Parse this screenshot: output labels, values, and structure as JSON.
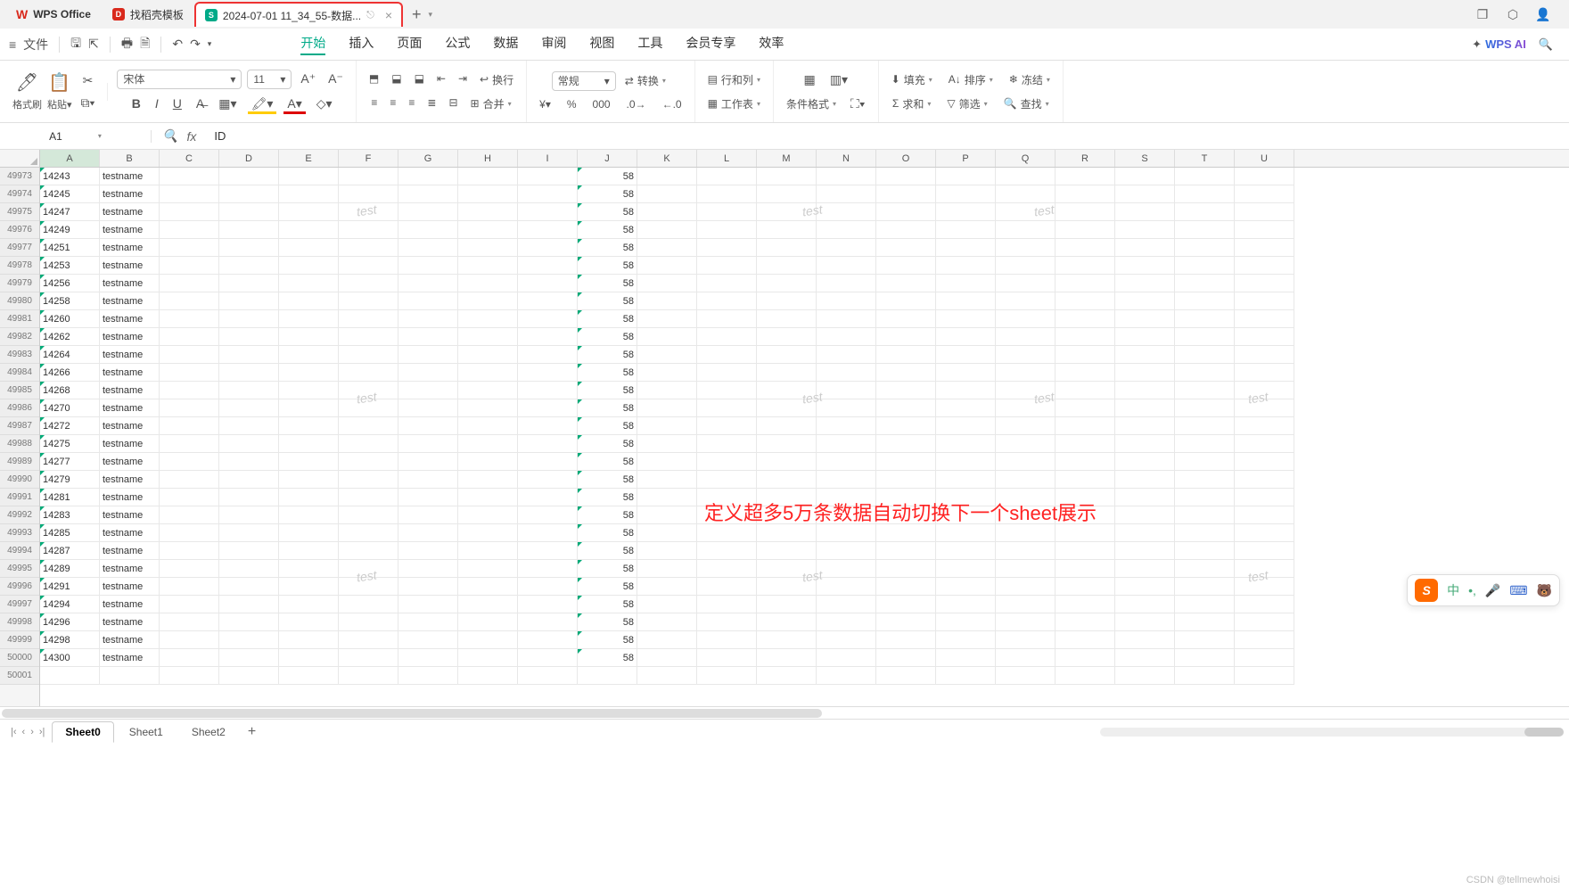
{
  "tabs": {
    "app": "WPS Office",
    "t1": "找稻壳模板",
    "t2": "2024-07-01 11_34_55-数据..."
  },
  "file_menu": "文件",
  "menu": [
    "开始",
    "插入",
    "页面",
    "公式",
    "数据",
    "审阅",
    "视图",
    "工具",
    "会员专享",
    "效率"
  ],
  "wpsai": "WPS AI",
  "ribbon": {
    "format_painter": "格式刷",
    "paste": "粘贴",
    "font_name": "宋体",
    "font_size": "11",
    "wrap": "换行",
    "merge": "合并",
    "num_format": "常规",
    "convert": "转换",
    "rowcol": "行和列",
    "sheet": "工作表",
    "cond": "条件格式",
    "fill": "填充",
    "sort": "排序",
    "freeze": "冻结",
    "sum": "求和",
    "filter": "筛选",
    "find": "查找"
  },
  "name_box": "A1",
  "fx_value": "ID",
  "columns": [
    "A",
    "B",
    "C",
    "D",
    "E",
    "F",
    "G",
    "H",
    "I",
    "J",
    "K",
    "L",
    "M",
    "N",
    "O",
    "P",
    "Q",
    "R",
    "S",
    "T",
    "U"
  ],
  "row_start": 49973,
  "data_rows": [
    {
      "r": 49973,
      "a": "14243",
      "b": "testname",
      "j": "58"
    },
    {
      "r": 49974,
      "a": "14245",
      "b": "testname",
      "j": "58"
    },
    {
      "r": 49975,
      "a": "14247",
      "b": "testname",
      "j": "58"
    },
    {
      "r": 49976,
      "a": "14249",
      "b": "testname",
      "j": "58"
    },
    {
      "r": 49977,
      "a": "14251",
      "b": "testname",
      "j": "58"
    },
    {
      "r": 49978,
      "a": "14253",
      "b": "testname",
      "j": "58"
    },
    {
      "r": 49979,
      "a": "14256",
      "b": "testname",
      "j": "58"
    },
    {
      "r": 49980,
      "a": "14258",
      "b": "testname",
      "j": "58"
    },
    {
      "r": 49981,
      "a": "14260",
      "b": "testname",
      "j": "58"
    },
    {
      "r": 49982,
      "a": "14262",
      "b": "testname",
      "j": "58"
    },
    {
      "r": 49983,
      "a": "14264",
      "b": "testname",
      "j": "58"
    },
    {
      "r": 49984,
      "a": "14266",
      "b": "testname",
      "j": "58"
    },
    {
      "r": 49985,
      "a": "14268",
      "b": "testname",
      "j": "58"
    },
    {
      "r": 49986,
      "a": "14270",
      "b": "testname",
      "j": "58"
    },
    {
      "r": 49987,
      "a": "14272",
      "b": "testname",
      "j": "58"
    },
    {
      "r": 49988,
      "a": "14275",
      "b": "testname",
      "j": "58"
    },
    {
      "r": 49989,
      "a": "14277",
      "b": "testname",
      "j": "58"
    },
    {
      "r": 49990,
      "a": "14279",
      "b": "testname",
      "j": "58"
    },
    {
      "r": 49991,
      "a": "14281",
      "b": "testname",
      "j": "58"
    },
    {
      "r": 49992,
      "a": "14283",
      "b": "testname",
      "j": "58"
    },
    {
      "r": 49993,
      "a": "14285",
      "b": "testname",
      "j": "58"
    },
    {
      "r": 49994,
      "a": "14287",
      "b": "testname",
      "j": "58"
    },
    {
      "r": 49995,
      "a": "14289",
      "b": "testname",
      "j": "58"
    },
    {
      "r": 49996,
      "a": "14291",
      "b": "testname",
      "j": "58"
    },
    {
      "r": 49997,
      "a": "14294",
      "b": "testname",
      "j": "58"
    },
    {
      "r": 49998,
      "a": "14296",
      "b": "testname",
      "j": "58"
    },
    {
      "r": 49999,
      "a": "14298",
      "b": "testname",
      "j": "58"
    },
    {
      "r": 50000,
      "a": "14300",
      "b": "testname",
      "j": "58"
    },
    {
      "r": 50001,
      "a": "",
      "b": "",
      "j": ""
    }
  ],
  "annotation": "定义超多5万条数据自动切换下一个sheet展示",
  "watermark": "test",
  "sheets": [
    "Sheet0",
    "Sheet1",
    "Sheet2"
  ],
  "ime_lang": "中",
  "credit": "CSDN @tellmewhoisi"
}
